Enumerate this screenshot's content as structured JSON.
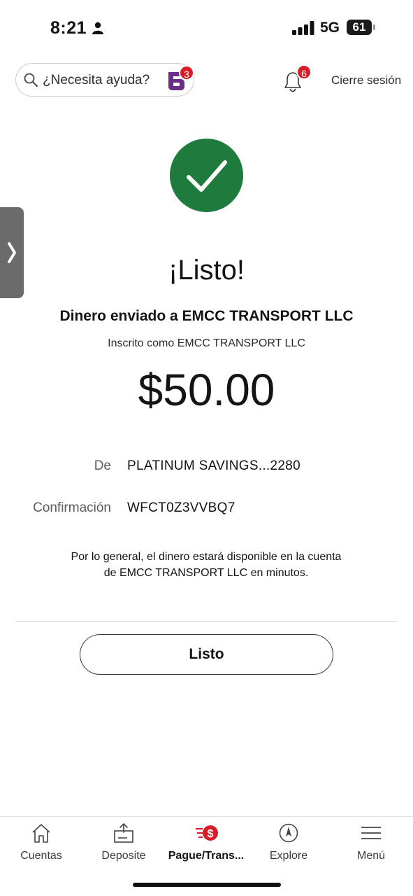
{
  "status_bar": {
    "time": "8:21",
    "network": "5G",
    "battery": "61"
  },
  "header": {
    "search_label": "¿Necesita ayuda?",
    "assistant_badge": "3",
    "notifications_badge": "6",
    "logout_label": "Cierre sesión"
  },
  "confirmation": {
    "headline": "¡Listo!",
    "title": "Dinero enviado a EMCC TRANSPORT LLC",
    "enrolled_as": "Inscrito como EMCC TRANSPORT LLC",
    "amount": "$50.00",
    "details": [
      {
        "label": "De",
        "value": "PLATINUM SAVINGS...2280"
      },
      {
        "label": "Confirmación",
        "value": "WFCT0Z3VVBQ7"
      }
    ],
    "note": "Por lo general, el dinero estará disponible en la cuenta de EMCC TRANSPORT LLC en minutos.",
    "done_label": "Listo"
  },
  "bottom_nav": {
    "items": [
      {
        "label": "Cuentas",
        "icon": "home-icon"
      },
      {
        "label": "Deposite",
        "icon": "deposit-icon"
      },
      {
        "label": "Pague/Trans...",
        "icon": "pay-transfer-icon",
        "active": true
      },
      {
        "label": "Explore",
        "icon": "compass-icon"
      },
      {
        "label": "Menú",
        "icon": "hamburger-menu-icon"
      }
    ]
  },
  "colors": {
    "success_green": "#1f7a3d",
    "badge_red": "#d71e28",
    "brand_purple": "#6c2c8a"
  }
}
